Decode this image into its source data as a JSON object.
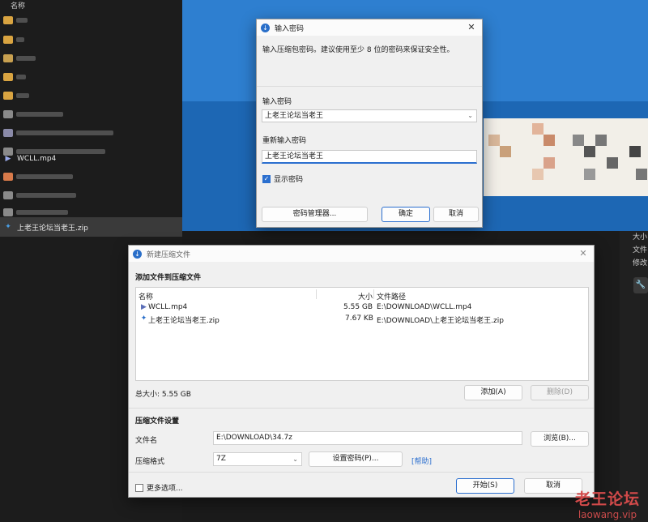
{
  "explorer": {
    "header": "名称",
    "files": [
      {
        "name": "WCLL.mp4",
        "icon": "video-file-icon"
      },
      {
        "name": "上老王论坛当老王.zip",
        "icon": "archive-file-icon"
      }
    ]
  },
  "side_panel": {
    "lines": [
      "大小",
      "文件",
      "修改"
    ]
  },
  "password_dialog": {
    "title": "输入密码",
    "description": "输入压缩包密码。建议使用至少 8 位的密码来保证安全性。",
    "label_password": "输入密码",
    "password_value": "上老王论坛当老王",
    "label_repeat": "重新输入密码",
    "repeat_value": "上老王论坛当老王",
    "show_password_label": "显示密码",
    "show_password_checked": true,
    "manager_button": "密码管理器...",
    "ok_button": "确定",
    "cancel_button": "取消"
  },
  "archive_dialog": {
    "title": "新建压缩文件",
    "section_add": "添加文件到压缩文件",
    "columns": {
      "name": "名称",
      "size": "大小",
      "path": "文件路径"
    },
    "rows": [
      {
        "name": "WCLL.mp4",
        "size": "5.55 GB",
        "path": "E:\\DOWNLOAD\\WCLL.mp4",
        "icon": "video-file-icon"
      },
      {
        "name": "上老王论坛当老王.zip",
        "size": "7.67 KB",
        "path": "E:\\DOWNLOAD\\上老王论坛当老王.zip",
        "icon": "archive-file-icon"
      }
    ],
    "total_size": "总大小: 5.55 GB",
    "add_button": "添加(A)",
    "delete_button": "删除(D)",
    "section_settings": "压缩文件设置",
    "filename_label": "文件名",
    "filename_value": "E:\\DOWNLOAD\\34.7z",
    "browse_button": "浏览(B)...",
    "format_label": "压缩格式",
    "format_value": "7Z",
    "set_password_button": "设置密码(P)...",
    "help_link": "[帮助]",
    "more_options_label": "更多选项...",
    "start_button": "开始(S)",
    "cancel_button": "取消"
  },
  "watermark": {
    "line1": "老王论坛",
    "line2": "laowang.vip"
  },
  "colors": {
    "accent": "#2b6fcf",
    "desktop_blue": "#2e7fd0",
    "watermark": "#d24a4a"
  }
}
